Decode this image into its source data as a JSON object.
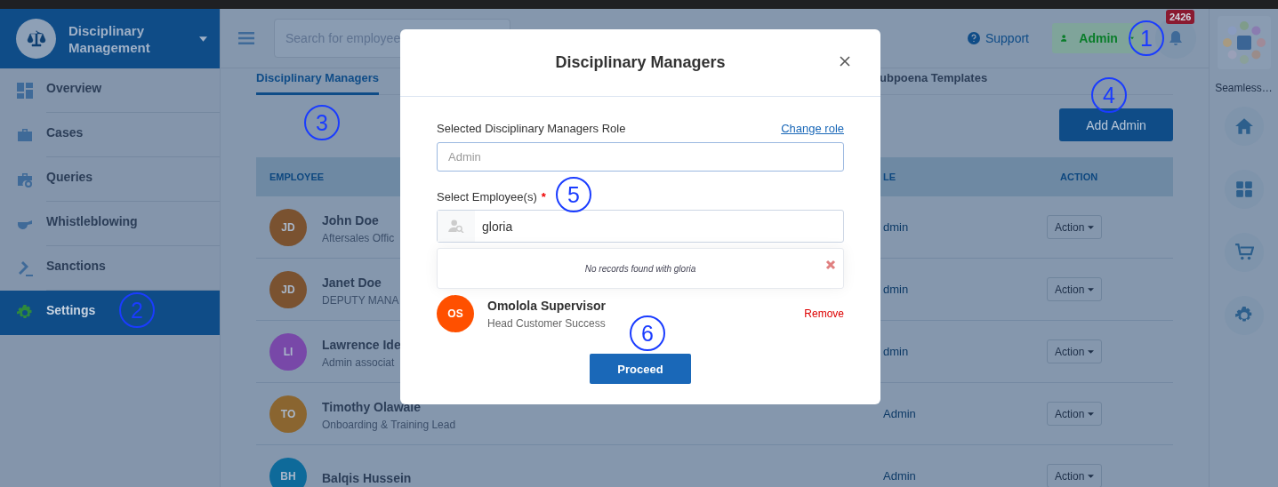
{
  "sidebar": {
    "title": "Disciplinary Management",
    "items": [
      {
        "label": "Overview",
        "selected": false
      },
      {
        "label": "Cases",
        "selected": false
      },
      {
        "label": "Queries",
        "selected": false
      },
      {
        "label": "Whistleblowing",
        "selected": false
      },
      {
        "label": "Sanctions",
        "selected": false
      },
      {
        "label": "Settings",
        "selected": true
      }
    ]
  },
  "topbar": {
    "search": {
      "placeholder": "Search for employee"
    },
    "support": "Support",
    "user_menu": "Admin",
    "notifications": "2426"
  },
  "tabs": [
    {
      "label": "Disciplinary Managers",
      "selected": true
    },
    {
      "label": "ubpoena Templates",
      "selected": false
    }
  ],
  "add_button": "Add Admin",
  "table": {
    "columns": [
      "EMPLOYEE",
      "LE",
      "ACTION"
    ],
    "rows": [
      {
        "initials": "JD",
        "color": "#7a5230",
        "name": "John Doe",
        "title": "Aftersales Offic",
        "role": "dmin",
        "action": "Action"
      },
      {
        "initials": "JD",
        "color": "#7a5230",
        "name": "Janet Doe",
        "title": "DEPUTY MANA",
        "role": "dmin",
        "action": "Action"
      },
      {
        "initials": "LI",
        "color": "#7848a8",
        "name": "Lawrence Ide",
        "title": "Admin associat",
        "role": "dmin",
        "action": "Action"
      },
      {
        "initials": "TO",
        "color": "#8a6530",
        "name": "Timothy Olawale",
        "title": "Onboarding & Training Lead",
        "role": "Admin",
        "action": "Action"
      },
      {
        "initials": "BH",
        "color": "#0e6a9a",
        "name": "Balqis Hussein",
        "role": "Admin",
        "action": "Action"
      }
    ]
  },
  "rail": {
    "app_name": "Seamless…"
  },
  "modal": {
    "title": "Disciplinary Managers",
    "role_label": "Selected Disciplinary Managers Role",
    "change_role": "Change role",
    "role_field": {
      "placeholder": "Admin"
    },
    "employee_label": "Select Employee(s)",
    "required_mark": "*",
    "employee_field": {
      "value": "gloria"
    },
    "no_results": "No records found with gloria",
    "selected_employees": [
      {
        "initials": "OS",
        "color": "#ff5000",
        "name": "Omolola Supervisor",
        "title": "Head Customer Success",
        "remove": "Remove"
      }
    ],
    "proceed": "Proceed"
  },
  "annotations": [
    "1",
    "2",
    "3",
    "4",
    "5",
    "6"
  ]
}
